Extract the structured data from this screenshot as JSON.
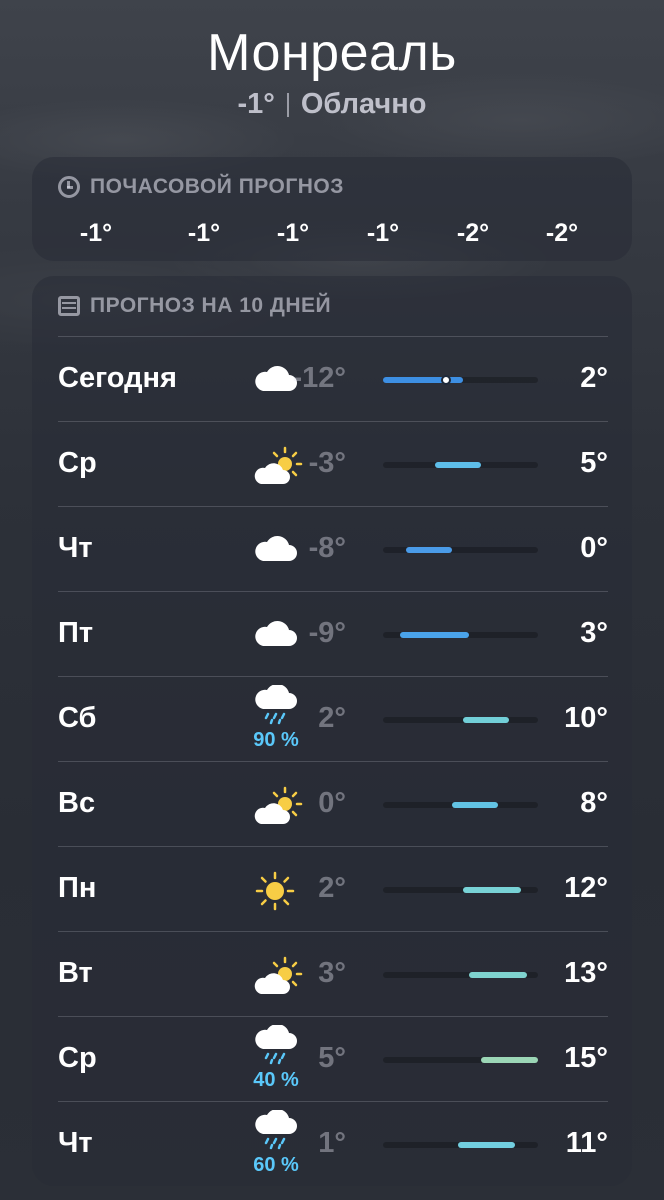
{
  "location": {
    "city": "Монреаль",
    "current_temp": "-1°",
    "condition": "Облачно"
  },
  "hourly": {
    "title": "ПОЧАСОВОЙ ПРОГНОЗ",
    "temps": [
      "-1°",
      "-1°",
      "-1°",
      "-1°",
      "-2°",
      "-2°"
    ]
  },
  "daily": {
    "title": "ПРОГНОЗ НА 10 ДНЕЙ",
    "scale": {
      "min": -12,
      "max": 15
    },
    "current_temp_value": -1,
    "days": [
      {
        "day": "Сегодня",
        "icon": "cloud-icon",
        "precip": "",
        "low": "-12°",
        "high": "2°",
        "low_value": -12,
        "high_value": 2,
        "color": "#3d8fe3",
        "now": true
      },
      {
        "day": "Ср",
        "icon": "partly-sunny-icon",
        "precip": "",
        "low": "-3°",
        "high": "5°",
        "low_value": -3,
        "high_value": 5,
        "color": "#5ebeea"
      },
      {
        "day": "Чт",
        "icon": "cloud-icon",
        "precip": "",
        "low": "-8°",
        "high": "0°",
        "low_value": -8,
        "high_value": 0,
        "color": "#4a9be8"
      },
      {
        "day": "Пт",
        "icon": "cloud-icon",
        "precip": "",
        "low": "-9°",
        "high": "3°",
        "low_value": -9,
        "high_value": 3,
        "color": "#4aa3ea"
      },
      {
        "day": "Сб",
        "icon": "cloud-rain-icon",
        "precip": "90 %",
        "low": "2°",
        "high": "10°",
        "low_value": 2,
        "high_value": 10,
        "color": "#72cfd8"
      },
      {
        "day": "Вс",
        "icon": "partly-sunny-icon",
        "precip": "",
        "low": "0°",
        "high": "8°",
        "low_value": 0,
        "high_value": 8,
        "color": "#62c3e4"
      },
      {
        "day": "Пн",
        "icon": "sun-icon",
        "precip": "",
        "low": "2°",
        "high": "12°",
        "low_value": 2,
        "high_value": 12,
        "color": "#78d2d6"
      },
      {
        "day": "Вт",
        "icon": "partly-sunny-icon",
        "precip": "",
        "low": "3°",
        "high": "13°",
        "low_value": 3,
        "high_value": 13,
        "color": "#7fd3cf"
      },
      {
        "day": "Ср",
        "icon": "cloud-rain-icon",
        "precip": "40 %",
        "low": "5°",
        "high": "15°",
        "low_value": 5,
        "high_value": 15,
        "color": "#9bd6b6"
      },
      {
        "day": "Чт",
        "icon": "cloud-rain-icon",
        "precip": "60 %",
        "low": "1°",
        "high": "11°",
        "low_value": 1,
        "high_value": 11,
        "color": "#72cfe0"
      }
    ]
  }
}
